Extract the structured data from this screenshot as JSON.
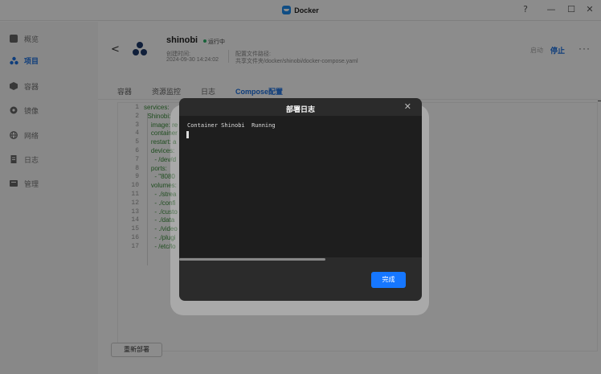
{
  "window": {
    "title": "Docker",
    "help": "?",
    "minimize": "—",
    "maximize": "☐",
    "close": "✕"
  },
  "sidebar": {
    "items": [
      {
        "label": "概览",
        "icon": "overview-icon",
        "active": false
      },
      {
        "label": "项目",
        "icon": "project-icon",
        "active": true
      },
      {
        "label": "容器",
        "icon": "container-icon",
        "active": false
      },
      {
        "label": "镜像",
        "icon": "image-icon",
        "active": false
      },
      {
        "label": "网络",
        "icon": "network-icon",
        "active": false
      },
      {
        "label": "日志",
        "icon": "log-icon",
        "active": false
      },
      {
        "label": "管理",
        "icon": "manage-icon",
        "active": false
      }
    ]
  },
  "project": {
    "back": "<",
    "name": "shinobi",
    "status": "运行中",
    "created_label": "创建时间:",
    "created_value": "2024-09-30 14:24:02",
    "config_label": "配置文件路径:",
    "config_value": "共享文件夹/docker/shinobi/docker-compose.yaml",
    "start": "启动",
    "stop": "停止",
    "more": "···"
  },
  "tabs": [
    {
      "label": "容器",
      "active": false
    },
    {
      "label": "资源监控",
      "active": false
    },
    {
      "label": "日志",
      "active": false
    },
    {
      "label": "Compose配置",
      "active": true
    }
  ],
  "editor": {
    "lines": [
      {
        "n": "1",
        "text": "services:"
      },
      {
        "n": "2",
        "text": "  Shinobi:"
      },
      {
        "n": "3",
        "text": "    image: re"
      },
      {
        "n": "4",
        "text": "    container"
      },
      {
        "n": "5",
        "text": "    restart: a"
      },
      {
        "n": "6",
        "text": "    devices:"
      },
      {
        "n": "7",
        "text": "      - /dev/d"
      },
      {
        "n": "8",
        "text": "    ports:"
      },
      {
        "n": "9",
        "text": "      - \"8080"
      },
      {
        "n": "10",
        "text": "    volumes:"
      },
      {
        "n": "11",
        "text": "      - ./strea"
      },
      {
        "n": "12",
        "text": "      - ./confi"
      },
      {
        "n": "13",
        "text": "      - ./custo"
      },
      {
        "n": "14",
        "text": "      - ./data"
      },
      {
        "n": "15",
        "text": "      - ./video"
      },
      {
        "n": "16",
        "text": "      - ./plugi"
      },
      {
        "n": "17",
        "text": "      - /etc/lo"
      }
    ]
  },
  "redeploy": "重新部署",
  "modal": {
    "title": "部署日志",
    "close": "✕",
    "log_line": "Container Shinobi  Running",
    "done": "完成"
  },
  "colors": {
    "accent": "#1677ff",
    "active_nav": "#1a6fe0",
    "status_running": "#2fb36b",
    "code_green": "#3a8c3a"
  }
}
